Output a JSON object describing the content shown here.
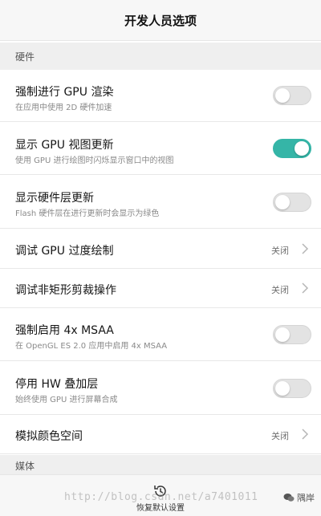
{
  "header": {
    "title": "开发人员选项"
  },
  "sections": {
    "hardware": "硬件",
    "media": "媒体"
  },
  "rows": [
    {
      "label": "强制进行 GPU 渲染",
      "desc": "在应用中使用 2D 硬件加速",
      "toggle_on": false
    },
    {
      "label": "显示 GPU 视图更新",
      "desc": "使用 GPU 进行绘图时闪烁显示窗口中的视图",
      "toggle_on": true
    },
    {
      "label": "显示硬件层更新",
      "desc": "Flash 硬件层在进行更新时会显示为绿色",
      "toggle_on": false
    },
    {
      "label": "调试 GPU 过度绘制",
      "value": "关闭"
    },
    {
      "label": "调试非矩形剪裁操作",
      "value": "关闭"
    },
    {
      "label": "强制启用 4x MSAA",
      "desc": "在 OpenGL ES 2.0 应用中启用 4x MSAA",
      "toggle_on": false
    },
    {
      "label": "停用 HW 叠加层",
      "desc": "始终使用 GPU 进行屏幕合成",
      "toggle_on": false
    },
    {
      "label": "模拟颜色空间",
      "value": "关闭"
    }
  ],
  "bottom": {
    "restore_label": "恢复默认设置",
    "restore_icon": "history-icon"
  },
  "watermark": {
    "text": "http://blog.csdn.net/a7401011",
    "brand": "隅岸"
  },
  "colors": {
    "accent": "#35b5a7",
    "section_bg": "#efefef",
    "toggle_off": "#e3e3e3"
  }
}
